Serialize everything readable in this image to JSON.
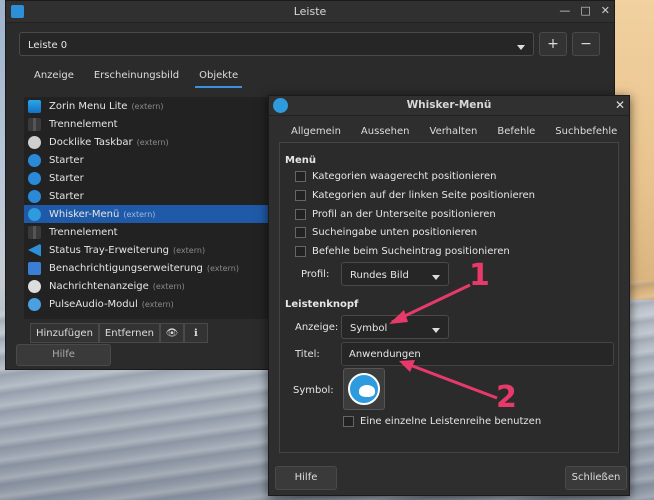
{
  "main_window": {
    "title": "Leiste",
    "panel_select": "Leiste 0",
    "add": "+",
    "remove": "−",
    "tabs": [
      "Anzeige",
      "Erscheinungsbild",
      "Objekte"
    ],
    "active_tab": "Objekte",
    "items": [
      {
        "name": "Zorin Menu Lite",
        "extern": "(extern)",
        "icon": "zorin-icon"
      },
      {
        "name": "Trennelement",
        "extern": "",
        "icon": "separator-icon"
      },
      {
        "name": "Docklike Taskbar",
        "extern": "(extern)",
        "icon": "docklike-icon"
      },
      {
        "name": "Starter",
        "extern": "",
        "icon": "launcher-icon"
      },
      {
        "name": "Starter",
        "extern": "",
        "icon": "launcher-icon"
      },
      {
        "name": "Starter",
        "extern": "",
        "icon": "launcher-icon"
      },
      {
        "name": "Whisker-Menü",
        "extern": "(extern)",
        "icon": "whisker-icon",
        "selected": true
      },
      {
        "name": "Trennelement",
        "extern": "",
        "icon": "separator-icon"
      },
      {
        "name": "Status Tray-Erweiterung",
        "extern": "(extern)",
        "icon": "tray-icon"
      },
      {
        "name": "Benachrichtigungserweiterung",
        "extern": "(extern)",
        "icon": "notification-icon"
      },
      {
        "name": "Nachrichtenanzeige",
        "extern": "(extern)",
        "icon": "indicator-icon"
      },
      {
        "name": "PulseAudio-Modul",
        "extern": "(extern)",
        "icon": "pulseaudio-icon"
      }
    ],
    "bottom_buttons": {
      "add": "Hinzufügen",
      "remove": "Entfernen"
    },
    "help": "Hilfe"
  },
  "dialog": {
    "title": "Whisker-Menü",
    "tabs": [
      "Allgemein",
      "Aussehen",
      "Verhalten",
      "Befehle",
      "Suchbefehle"
    ],
    "active_tab": "Aussehen",
    "menu_section": "Menü",
    "checkboxes": [
      "Kategorien waagerecht positionieren",
      "Kategorien auf der linken Seite positionieren",
      "Profil an der Unterseite positionieren",
      "Sucheingabe unten positionieren",
      "Befehle beim Sucheintrag positionieren"
    ],
    "profile_label": "Profil:",
    "profile_value": "Rundes Bild",
    "panel_button_section": "Leistenknopf",
    "display_label": "Anzeige:",
    "display_value": "Symbol",
    "title_label": "Titel:",
    "title_value": "Anwendungen",
    "symbol_label": "Symbol:",
    "single_row": "Eine einzelne Leistenreihe benutzen",
    "help": "Hilfe",
    "close": "Schließen"
  },
  "annotations": {
    "one": "1",
    "two": "2",
    "color": "#e83a6a"
  }
}
